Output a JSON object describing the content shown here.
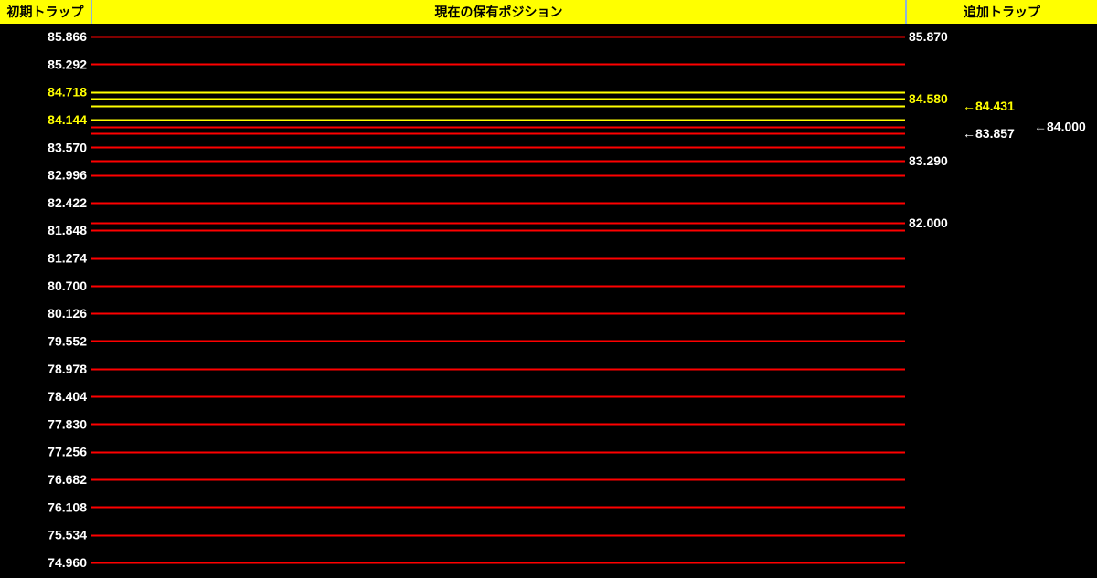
{
  "header": {
    "initial_trap": "初期トラップ",
    "current_positions": "現在の保有ポジション",
    "additional_trap": "追加トラップ"
  },
  "colors": {
    "background": "#000000",
    "header_bg": "#ffff00",
    "red": "#ff0000",
    "yellow": "#ffff00",
    "white": "#ffffff"
  },
  "chart_data": {
    "type": "line",
    "title": "",
    "initial_trap_labels": [
      {
        "text": "85.866",
        "value": 85.866,
        "color": "white"
      },
      {
        "text": "85.292",
        "value": 85.292,
        "color": "white"
      },
      {
        "text": "84.718",
        "value": 84.718,
        "color": "yellow"
      },
      {
        "text": "84.144",
        "value": 84.144,
        "color": "yellow"
      },
      {
        "text": "83.570",
        "value": 83.57,
        "color": "white"
      },
      {
        "text": "82.996",
        "value": 82.996,
        "color": "white"
      },
      {
        "text": "82.422",
        "value": 82.422,
        "color": "white"
      },
      {
        "text": "81.848",
        "value": 81.848,
        "color": "white"
      },
      {
        "text": "81.274",
        "value": 81.274,
        "color": "white"
      },
      {
        "text": "80.700",
        "value": 80.7,
        "color": "white"
      },
      {
        "text": "80.126",
        "value": 80.126,
        "color": "white"
      },
      {
        "text": "79.552",
        "value": 79.552,
        "color": "white"
      },
      {
        "text": "78.978",
        "value": 78.978,
        "color": "white"
      },
      {
        "text": "78.404",
        "value": 78.404,
        "color": "white"
      },
      {
        "text": "77.830",
        "value": 77.83,
        "color": "white"
      },
      {
        "text": "77.256",
        "value": 77.256,
        "color": "white"
      },
      {
        "text": "76.682",
        "value": 76.682,
        "color": "white"
      },
      {
        "text": "76.108",
        "value": 76.108,
        "color": "white"
      },
      {
        "text": "75.534",
        "value": 75.534,
        "color": "white"
      },
      {
        "text": "74.960",
        "value": 74.96,
        "color": "white"
      }
    ],
    "position_lines": [
      {
        "value": 85.87,
        "color": "red"
      },
      {
        "value": 85.866,
        "color": "red"
      },
      {
        "value": 85.292,
        "color": "red"
      },
      {
        "value": 84.718,
        "color": "yellow"
      },
      {
        "value": 84.58,
        "color": "yellow"
      },
      {
        "value": 84.431,
        "color": "yellow"
      },
      {
        "value": 84.144,
        "color": "yellow"
      },
      {
        "value": 84.0,
        "color": "red"
      },
      {
        "value": 83.857,
        "color": "red"
      },
      {
        "value": 83.57,
        "color": "red"
      },
      {
        "value": 83.29,
        "color": "red"
      },
      {
        "value": 82.996,
        "color": "red"
      },
      {
        "value": 82.422,
        "color": "red"
      },
      {
        "value": 82.0,
        "color": "red"
      },
      {
        "value": 81.848,
        "color": "red"
      },
      {
        "value": 81.274,
        "color": "red"
      },
      {
        "value": 80.7,
        "color": "red"
      },
      {
        "value": 80.126,
        "color": "red"
      },
      {
        "value": 79.552,
        "color": "red"
      },
      {
        "value": 78.978,
        "color": "red"
      },
      {
        "value": 78.404,
        "color": "red"
      },
      {
        "value": 77.83,
        "color": "red"
      },
      {
        "value": 77.256,
        "color": "red"
      },
      {
        "value": 76.682,
        "color": "red"
      },
      {
        "value": 76.108,
        "color": "red"
      },
      {
        "value": 75.534,
        "color": "red"
      },
      {
        "value": 74.96,
        "color": "red"
      }
    ],
    "additional_trap_labels": [
      {
        "text": "85.870",
        "value": 85.87,
        "color": "white",
        "column": 1
      },
      {
        "text": "84.580",
        "value": 84.58,
        "color": "yellow",
        "column": 1
      },
      {
        "text": "83.290",
        "value": 83.29,
        "color": "white",
        "column": 1
      },
      {
        "text": "82.000",
        "value": 82.0,
        "color": "white",
        "column": 1
      },
      {
        "text": "←84.431",
        "value": 84.431,
        "color": "yellow",
        "column": 2
      },
      {
        "text": "←83.857",
        "value": 83.857,
        "color": "white",
        "column": 2
      },
      {
        "text": "←84.000",
        "value": 84.0,
        "color": "white",
        "column": 3
      }
    ],
    "ylim": [
      74.96,
      85.87
    ]
  }
}
